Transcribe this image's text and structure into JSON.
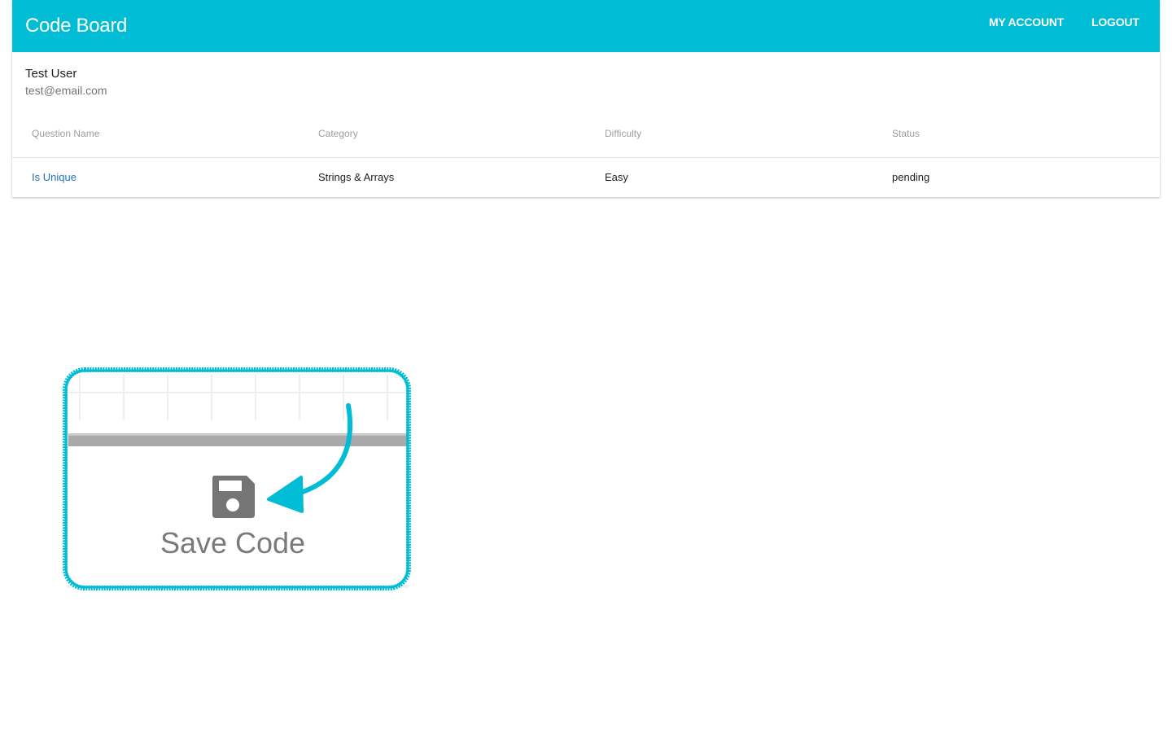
{
  "app": {
    "title": "Code Board",
    "brand_color": "#00bcd4"
  },
  "nav": {
    "my_account": "MY ACCOUNT",
    "logout": "LOGOUT"
  },
  "user": {
    "name": "Test User",
    "email": "test@email.com"
  },
  "table": {
    "columns": [
      "Question Name",
      "Category",
      "Difficulty",
      "Status"
    ],
    "rows": [
      {
        "name": "Is Unique",
        "category": "Strings & Arrays",
        "difficulty": "Easy",
        "status": "pending"
      }
    ]
  },
  "hint": {
    "label": "Save Code",
    "icon": "floppy-disk-icon",
    "outline_color": "#00bcd4"
  }
}
